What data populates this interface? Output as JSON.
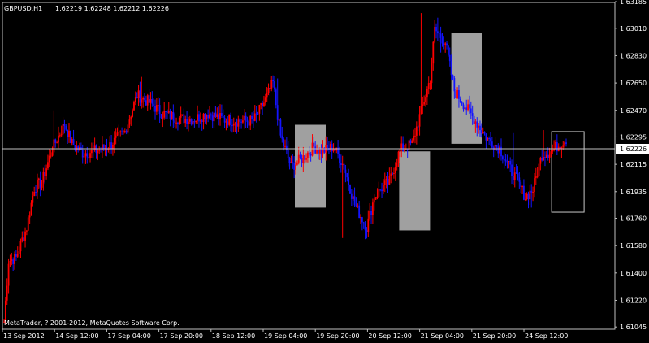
{
  "header": {
    "symbol": "GBPUSD,H1",
    "quote": "1.62219 1.62248 1.62212 1.62226"
  },
  "watermark": "MetaTrader, ? 2001-2012, MetaQuotes Software Corp.",
  "colors": {
    "background": "#000000",
    "axis": "#c0c0c0",
    "bull": "#ff0000",
    "bear": "#1414ff",
    "highlight": "#a0a0a0",
    "current_line": "#c0c0c0",
    "price_tag_bg": "#ffffff",
    "price_tag_text": "#000000"
  },
  "chart_data": {
    "type": "candlestick",
    "title": "GBPUSD,H1",
    "ylim": [
      1.6103,
      1.6318
    ],
    "y_ticks": [
      "1.63185",
      "1.63010",
      "1.62830",
      "1.62650",
      "1.62470",
      "1.62295",
      "1.62115",
      "1.61935",
      "1.61760",
      "1.61580",
      "1.61400",
      "1.61220",
      "1.61045"
    ],
    "x_ticks": [
      "13 Sep 2012",
      "14 Sep 12:00",
      "17 Sep 04:00",
      "17 Sep 20:00",
      "18 Sep 12:00",
      "19 Sep 04:00",
      "19 Sep 20:00",
      "20 Sep 12:00",
      "21 Sep 04:00",
      "21 Sep 20:00",
      "24 Sep 12:00"
    ],
    "current_price": "1.62226",
    "price_anchors": [
      [
        0,
        1.6108
      ],
      [
        3,
        1.6148
      ],
      [
        8,
        1.615
      ],
      [
        12,
        1.6162
      ],
      [
        15,
        1.617
      ],
      [
        20,
        1.6196
      ],
      [
        25,
        1.62
      ],
      [
        32,
        1.6222
      ],
      [
        40,
        1.6238
      ],
      [
        45,
        1.6225
      ],
      [
        52,
        1.6219
      ],
      [
        60,
        1.622
      ],
      [
        70,
        1.6224
      ],
      [
        80,
        1.6233
      ],
      [
        88,
        1.6257
      ],
      [
        95,
        1.6253
      ],
      [
        105,
        1.6245
      ],
      [
        115,
        1.6242
      ],
      [
        125,
        1.6241
      ],
      [
        135,
        1.6245
      ],
      [
        145,
        1.6241
      ],
      [
        155,
        1.624
      ],
      [
        165,
        1.624
      ],
      [
        172,
        1.6252
      ],
      [
        178,
        1.6265
      ],
      [
        183,
        1.623
      ],
      [
        190,
        1.621
      ],
      [
        198,
        1.6216
      ],
      [
        205,
        1.6223
      ],
      [
        210,
        1.622
      ],
      [
        218,
        1.6223
      ],
      [
        225,
        1.621
      ],
      [
        232,
        1.6185
      ],
      [
        240,
        1.617
      ],
      [
        245,
        1.619
      ],
      [
        250,
        1.6196
      ],
      [
        255,
        1.62
      ],
      [
        262,
        1.6221
      ],
      [
        270,
        1.6225
      ],
      [
        277,
        1.625
      ],
      [
        282,
        1.6268
      ],
      [
        285,
        1.63
      ],
      [
        292,
        1.6292
      ],
      [
        298,
        1.626
      ],
      [
        305,
        1.625
      ],
      [
        312,
        1.624
      ],
      [
        320,
        1.6228
      ],
      [
        328,
        1.6222
      ],
      [
        334,
        1.621
      ],
      [
        340,
        1.62
      ],
      [
        345,
        1.619
      ],
      [
        350,
        1.6195
      ],
      [
        356,
        1.6218
      ],
      [
        362,
        1.622
      ],
      [
        368,
        1.6225
      ],
      [
        372,
        1.6228
      ]
    ],
    "spikes": [
      [
        33,
        1.6247
      ],
      [
        41,
        1.6238
      ],
      [
        91,
        1.6269
      ],
      [
        181,
        1.6268
      ],
      [
        224,
        1.6163
      ],
      [
        276,
        1.6311
      ],
      [
        287,
        1.6308
      ],
      [
        289,
        1.6285
      ],
      [
        337,
        1.6232
      ],
      [
        349,
        1.6183
      ],
      [
        357,
        1.6234
      ]
    ],
    "highlight_boxes": [
      {
        "from": [
          "19 Sep 04:00",
          "19 Sep 20:00"
        ],
        "range": [
          1.6183,
          1.62375
        ]
      },
      {
        "from": [
          "20 Sep 12:00",
          "21 Sep 04:00"
        ],
        "range": [
          1.6168,
          1.622
        ]
      },
      {
        "from": [
          "21 Sep 04:00",
          "21 Sep 20:00"
        ],
        "range": [
          1.6225,
          1.6298
        ]
      },
      {
        "from": [
          "24 Sep 04:00",
          "24 Sep 12:00"
        ],
        "range": [
          1.618,
          1.6233
        ],
        "style": "outline"
      }
    ],
    "grid": false,
    "legend": "none"
  }
}
